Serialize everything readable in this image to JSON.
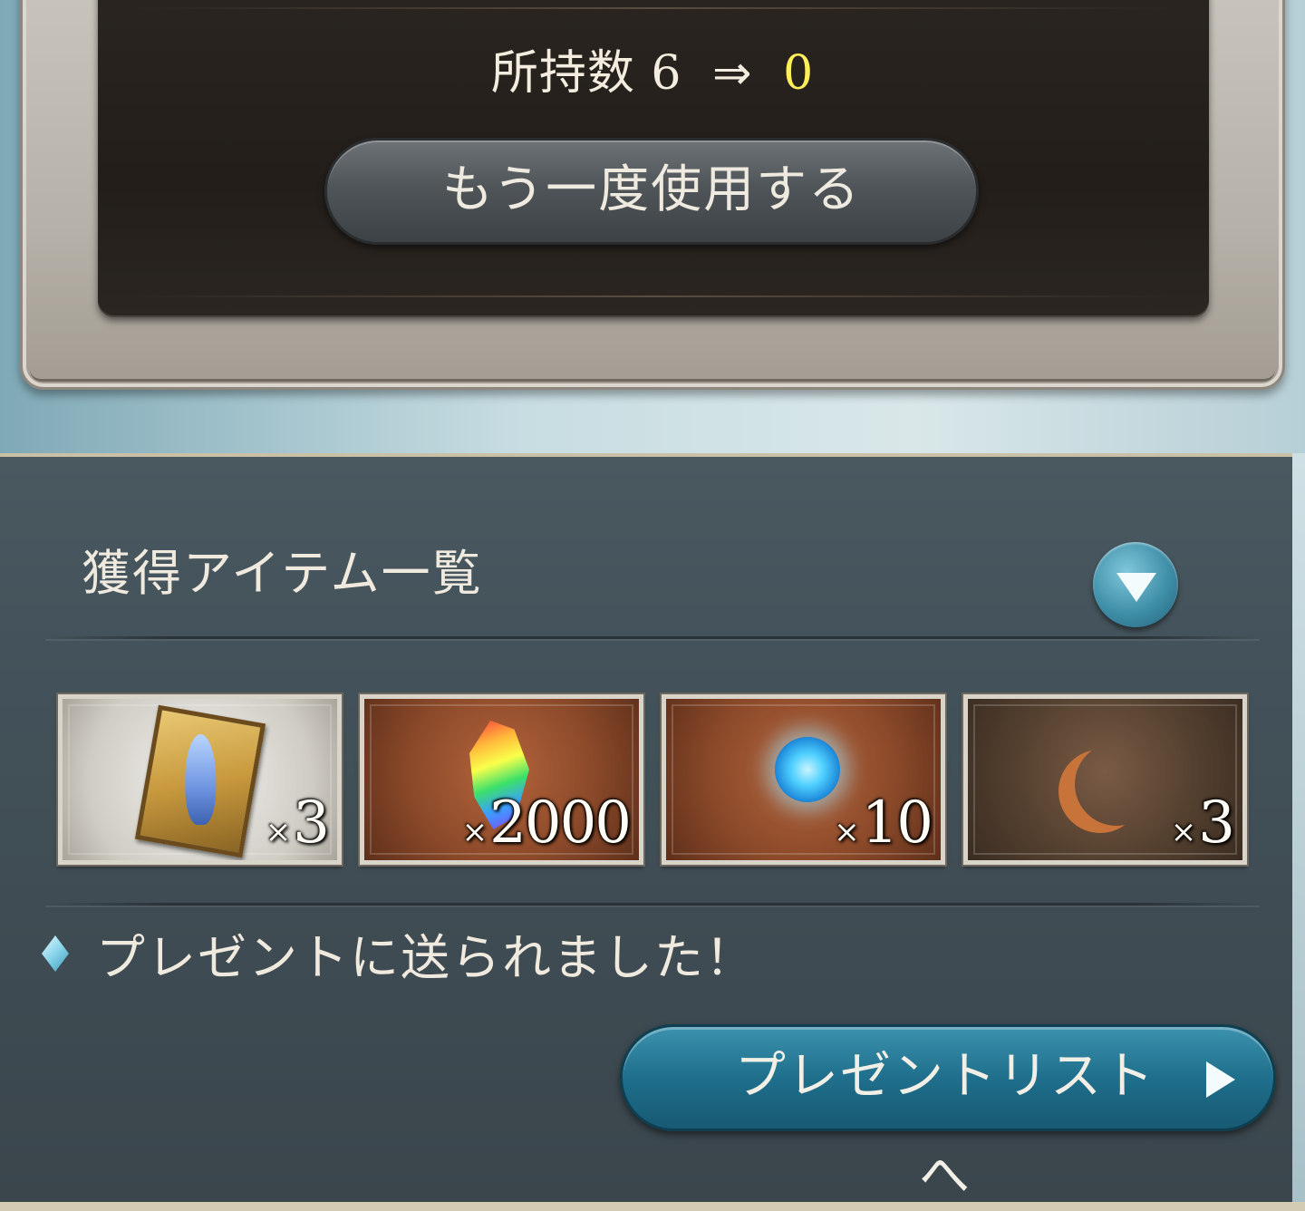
{
  "dialog": {
    "owned_label": "所持数",
    "owned_before": "6",
    "arrow": "⇒",
    "owned_after": "0",
    "use_again_label": "もう一度使用する"
  },
  "rewards": {
    "title": "獲得アイテム一覧",
    "collapse_icon": "triangle-down-icon",
    "items": [
      {
        "icon": "crystal-ticket-icon",
        "qty_prefix": "×",
        "qty": "3"
      },
      {
        "icon": "rainbow-prism-icon",
        "qty_prefix": "×",
        "qty": "2000"
      },
      {
        "icon": "blue-orb-icon",
        "qty_prefix": "×",
        "qty": "10"
      },
      {
        "icon": "crescent-moon-icon",
        "qty_prefix": "×",
        "qty": "3"
      }
    ],
    "notice": "プレゼントに送られました！",
    "present_list_label": "プレゼントリストへ"
  },
  "colors": {
    "highlight_number": "#ffef5a",
    "accent_button": "#1f6f8c"
  }
}
